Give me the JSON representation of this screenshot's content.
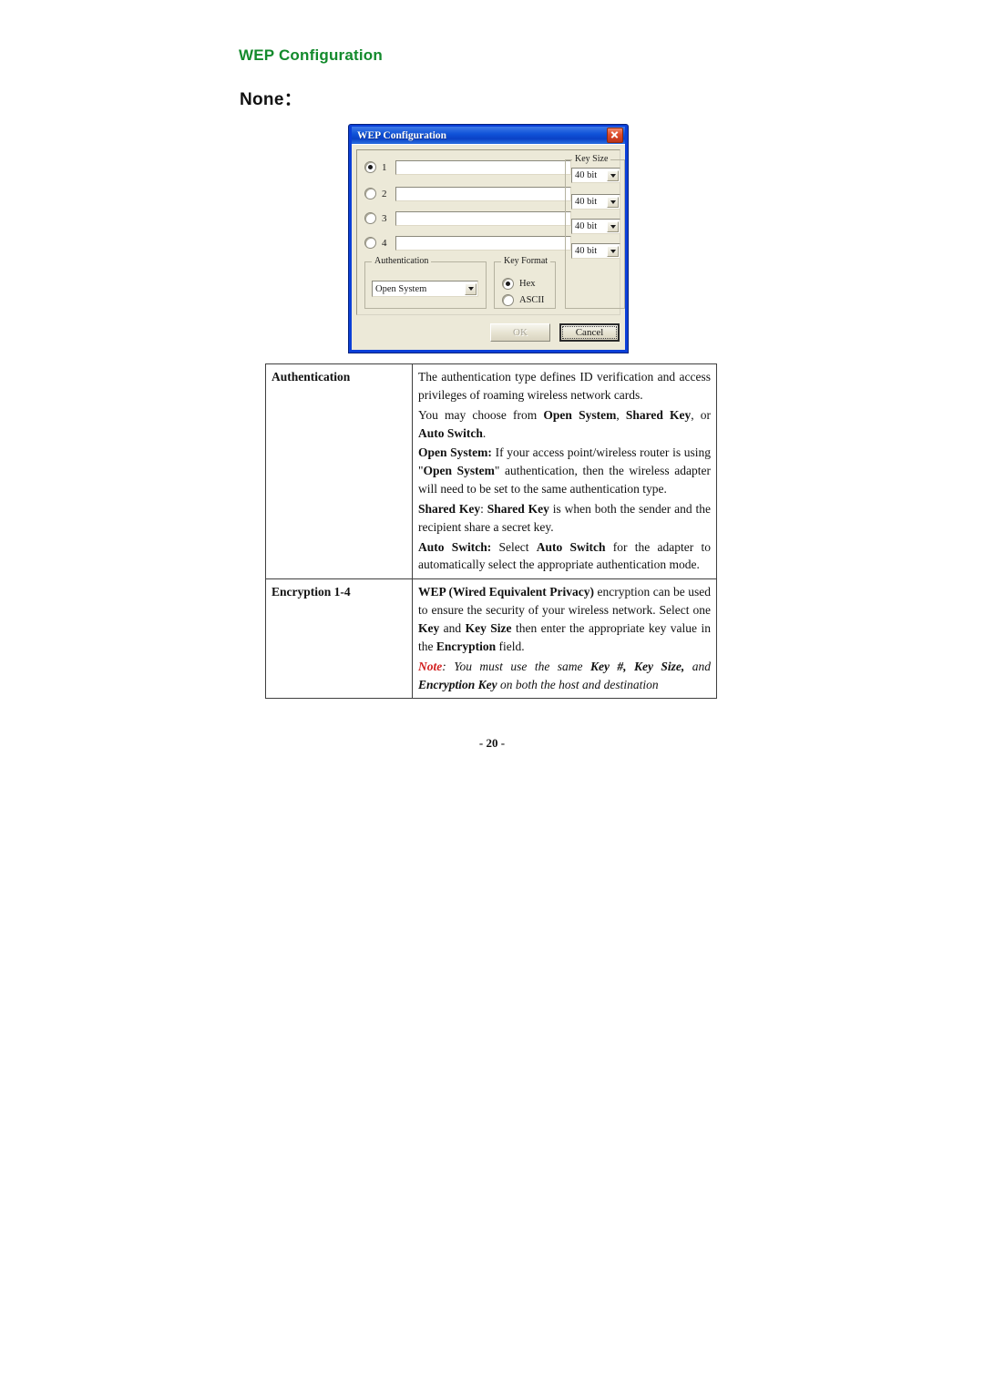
{
  "page": {
    "heading": "WEP Configuration",
    "section_label": "None：",
    "footer": "- 20 -",
    "heading_color": "#138a2c",
    "note_color": "#d21f1f"
  },
  "dialog": {
    "title": "WEP Configuration",
    "close_icon": "close-icon",
    "keys": [
      {
        "number": "1",
        "selected": true,
        "value": "",
        "key_size": "40 bit"
      },
      {
        "number": "2",
        "selected": false,
        "value": "",
        "key_size": "40 bit"
      },
      {
        "number": "3",
        "selected": false,
        "value": "",
        "key_size": "40 bit"
      },
      {
        "number": "4",
        "selected": false,
        "value": "",
        "key_size": "40 bit"
      }
    ],
    "key_size_group_label": "Key Size",
    "authentication": {
      "group_label": "Authentication",
      "selected": "Open System"
    },
    "key_format": {
      "group_label": "Key Format",
      "options": [
        {
          "label": "Hex",
          "selected": true
        },
        {
          "label": "ASCII",
          "selected": false
        }
      ]
    },
    "buttons": {
      "ok": "OK",
      "ok_disabled": true,
      "cancel": "Cancel",
      "cancel_focused": true
    }
  },
  "table": {
    "rows": [
      {
        "term": "Authentication",
        "paragraphs": [
          "p_auth_1",
          "p_auth_2",
          "p_auth_3",
          "p_auth_4",
          "p_auth_5"
        ]
      },
      {
        "term": "Encryption 1-4",
        "paragraphs": [
          "p_enc_1",
          "p_enc_2"
        ]
      }
    ],
    "text": {
      "p_auth_1_a": "The authentication type defines ID verification and access privileges of roaming wireless network cards.",
      "p_auth_2_a": "You may choose from ",
      "p_auth_2_b": "Open System",
      "p_auth_2_c": ", ",
      "p_auth_2_d": "Shared Key",
      "p_auth_2_e": ", or ",
      "p_auth_2_f": "Auto Switch",
      "p_auth_2_g": ".",
      "p_auth_3_a": "Open System:",
      "p_auth_3_b": " If your access point/wireless router is using \"",
      "p_auth_3_c": "Open System",
      "p_auth_3_d": "\" authentication, then the wireless adapter will need to be set to the same authentication type.",
      "p_auth_4_a": "Shared Key",
      "p_auth_4_b": ": ",
      "p_auth_4_c": "Shared Key",
      "p_auth_4_d": " is when both the sender and the recipient share a secret key.",
      "p_auth_5_a": "Auto Switch:",
      "p_auth_5_b": " Select ",
      "p_auth_5_c": "Auto Switch",
      "p_auth_5_d": " for the adapter to automatically select the appropriate authentication mode.",
      "p_enc_1_a": "WEP (Wired Equivalent Privacy)",
      "p_enc_1_b": " encryption can be used to ensure the security of your wireless network. Select one ",
      "p_enc_1_c": "Key",
      "p_enc_1_d": " and ",
      "p_enc_1_e": "Key Size",
      "p_enc_1_f": " then enter the appropriate key value in the ",
      "p_enc_1_g": "Encryption",
      "p_enc_1_h": " field.",
      "p_enc_2_a": "Note",
      "p_enc_2_b": ": ",
      "p_enc_2_c": "You must use the same ",
      "p_enc_2_d": "Key #, Key Size,",
      "p_enc_2_e": " and ",
      "p_enc_2_f": "Encryption Key",
      "p_enc_2_g": " on both the host and destination"
    }
  }
}
